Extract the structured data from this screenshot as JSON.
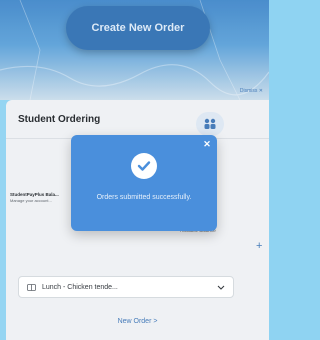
{
  "header": {
    "create_order_label": "Create New Order",
    "dismiss_label": "Dismiss ✕"
  },
  "card": {
    "title": "Student Ordering",
    "account_name": "StudentPayPlus Bala...",
    "account_sub": "Manage your account...",
    "available_balance_label": "Available Balance",
    "meal_select_value": "Lunch - Chicken tende...",
    "new_order_label": "New Order  >"
  },
  "toast": {
    "message": "Orders submitted successfully."
  },
  "colors": {
    "header_pill": "#2e6fb2",
    "toast_bg": "#4a8fdc",
    "accent": "#3c74b5",
    "page_bg": "#8fd3f2"
  },
  "icons": [
    "map-background",
    "users-icon",
    "check-icon",
    "close-icon",
    "meal-icon",
    "chevron-down-icon",
    "plus-icon"
  ]
}
